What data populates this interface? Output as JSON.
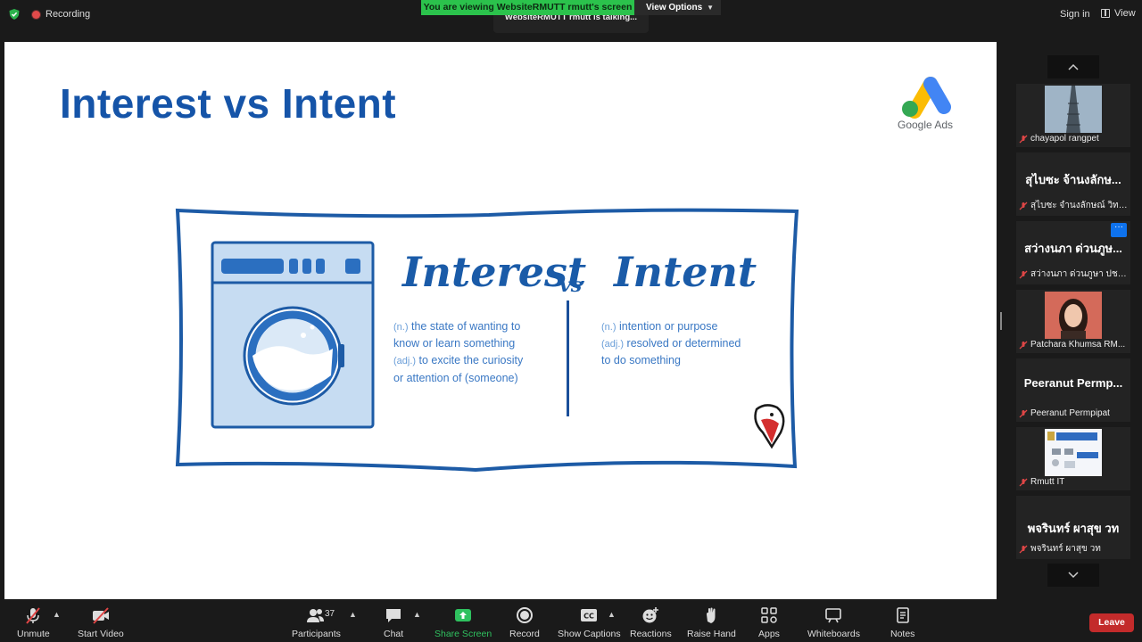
{
  "top": {
    "recording": "Recording",
    "viewing_banner": "You are viewing WebsiteRMUTT rmutt's screen",
    "view_options": "View Options",
    "talking": "WebsiteRMUTT rmutt is talking...",
    "sign_in": "Sign in",
    "view": "View"
  },
  "slide": {
    "title": "Interest vs Intent",
    "brand": "Google Ads",
    "word_left": "Interest",
    "word_vs": "vs",
    "word_right": "Intent",
    "left_defs": [
      {
        "abbr": "(n.)",
        "text": " the state of wanting to"
      },
      {
        "abbr": "",
        "text": "know or learn something"
      },
      {
        "abbr": "(adj.)",
        "text": " to excite the curiosity"
      },
      {
        "abbr": "",
        "text": "or attention of (someone)"
      }
    ],
    "right_defs": [
      {
        "abbr": "(n.)",
        "text": " intention or purpose"
      },
      {
        "abbr": "(adj.)",
        "text": " resolved or determined"
      },
      {
        "abbr": "",
        "text": "to do something"
      }
    ]
  },
  "participants_strip": [
    {
      "display": "",
      "label": "chayapol rangpet",
      "has_photo": true
    },
    {
      "display": "สุไบซะ จ้านงลักษ...",
      "label": "สุไบซะ จำนงลักษณ์ วิทยา..."
    },
    {
      "display": "สว่างนภา ด่วนภูษ...",
      "label": "สว่างนภา ด่วนภูษา ปชส...."
    },
    {
      "display": "",
      "label": "Patchara Khumsa RM...",
      "has_photo": true
    },
    {
      "display": "Peeranut  Permp...",
      "label": "Peeranut Permpipat"
    },
    {
      "display": "",
      "label": "Rmutt IT",
      "has_photo": true
    },
    {
      "display": "พจรินทร์ ผาสุข วท",
      "label": "พจรินทร์ ผาสุข วท"
    }
  ],
  "toolbar": {
    "unmute": "Unmute",
    "start_video": "Start Video",
    "participants": "Participants",
    "participants_count": "37",
    "chat": "Chat",
    "share_screen": "Share Screen",
    "record": "Record",
    "show_captions": "Show Captions",
    "reactions": "Reactions",
    "raise_hand": "Raise Hand",
    "apps": "Apps",
    "whiteboards": "Whiteboards",
    "notes": "Notes",
    "leave": "Leave"
  },
  "colors": {
    "accent_green": "#2bc24c",
    "slide_blue": "#1554a8",
    "leave_red": "#c32b2b",
    "more_blue": "#0e72ed"
  }
}
